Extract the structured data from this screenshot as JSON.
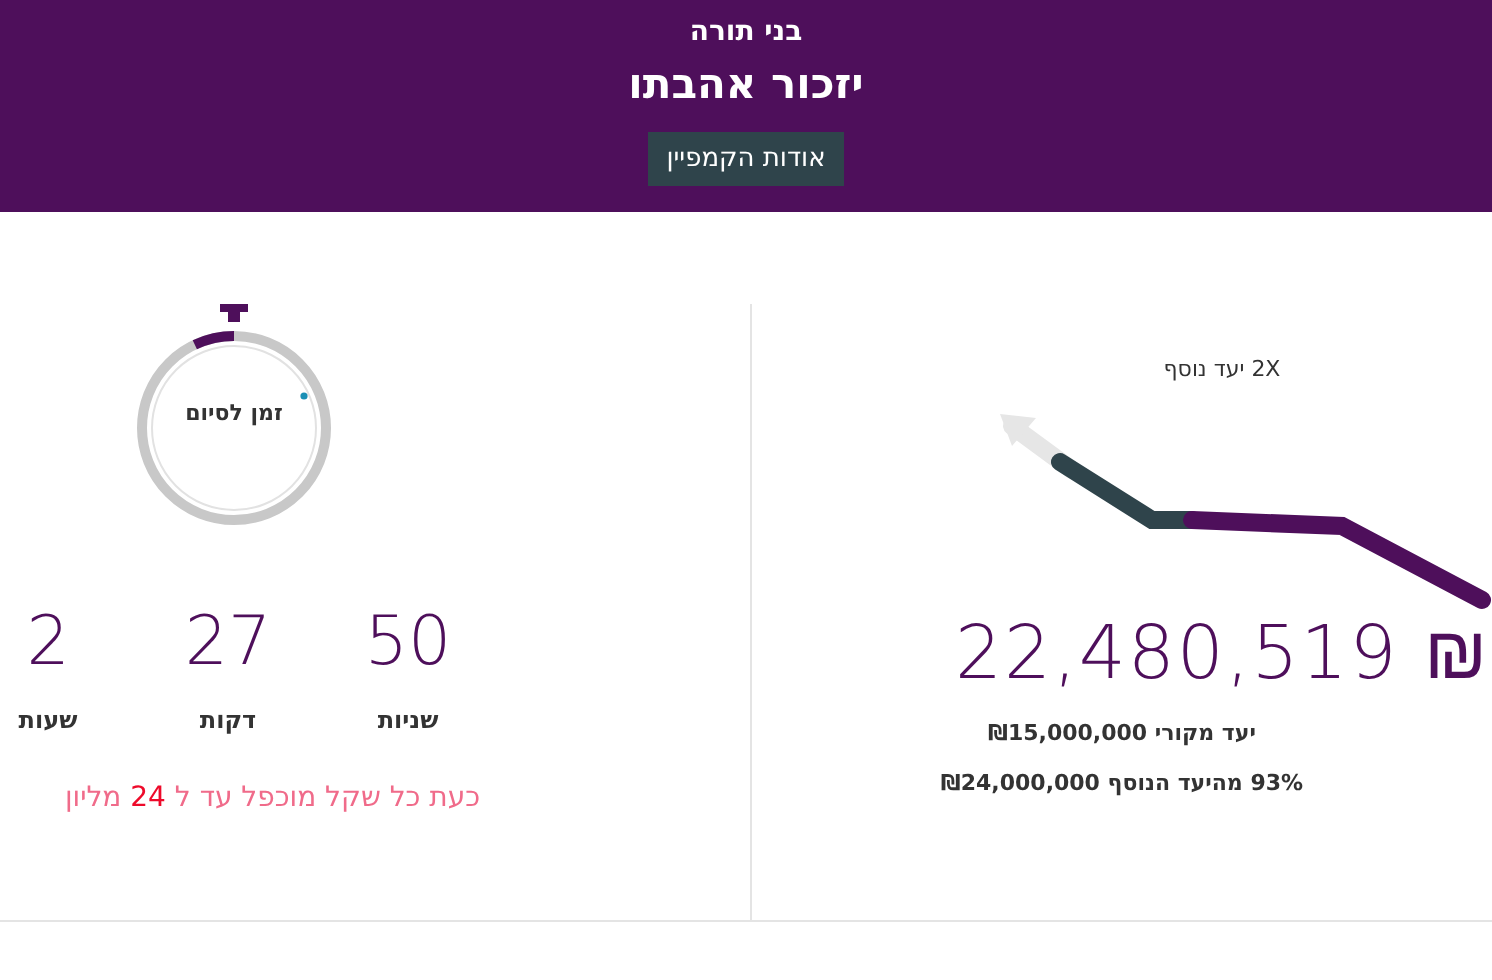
{
  "header": {
    "subtitle": "בני תורה",
    "title": "יזכור אהבתו",
    "button": "אודות הקמפיין"
  },
  "campaign": {
    "bonus_label": "2X יעד נוסף",
    "amount": "22,480,519 ₪",
    "goals": [
      "יעד מקורי ₪15,000,000",
      "93% מהיעד הנוסף ₪24,000,000"
    ]
  },
  "timer": {
    "label": "זמן לסיום",
    "level": 0.07,
    "units": [
      {
        "value": "50",
        "label": "שניות"
      },
      {
        "value": "27",
        "label": "דקות"
      },
      {
        "value": "2",
        "label": "שעות"
      }
    ],
    "note": {
      "before": "כעת כל שקל מוכפל עד ל",
      "highlight": "24",
      "after": "מליון"
    }
  }
}
